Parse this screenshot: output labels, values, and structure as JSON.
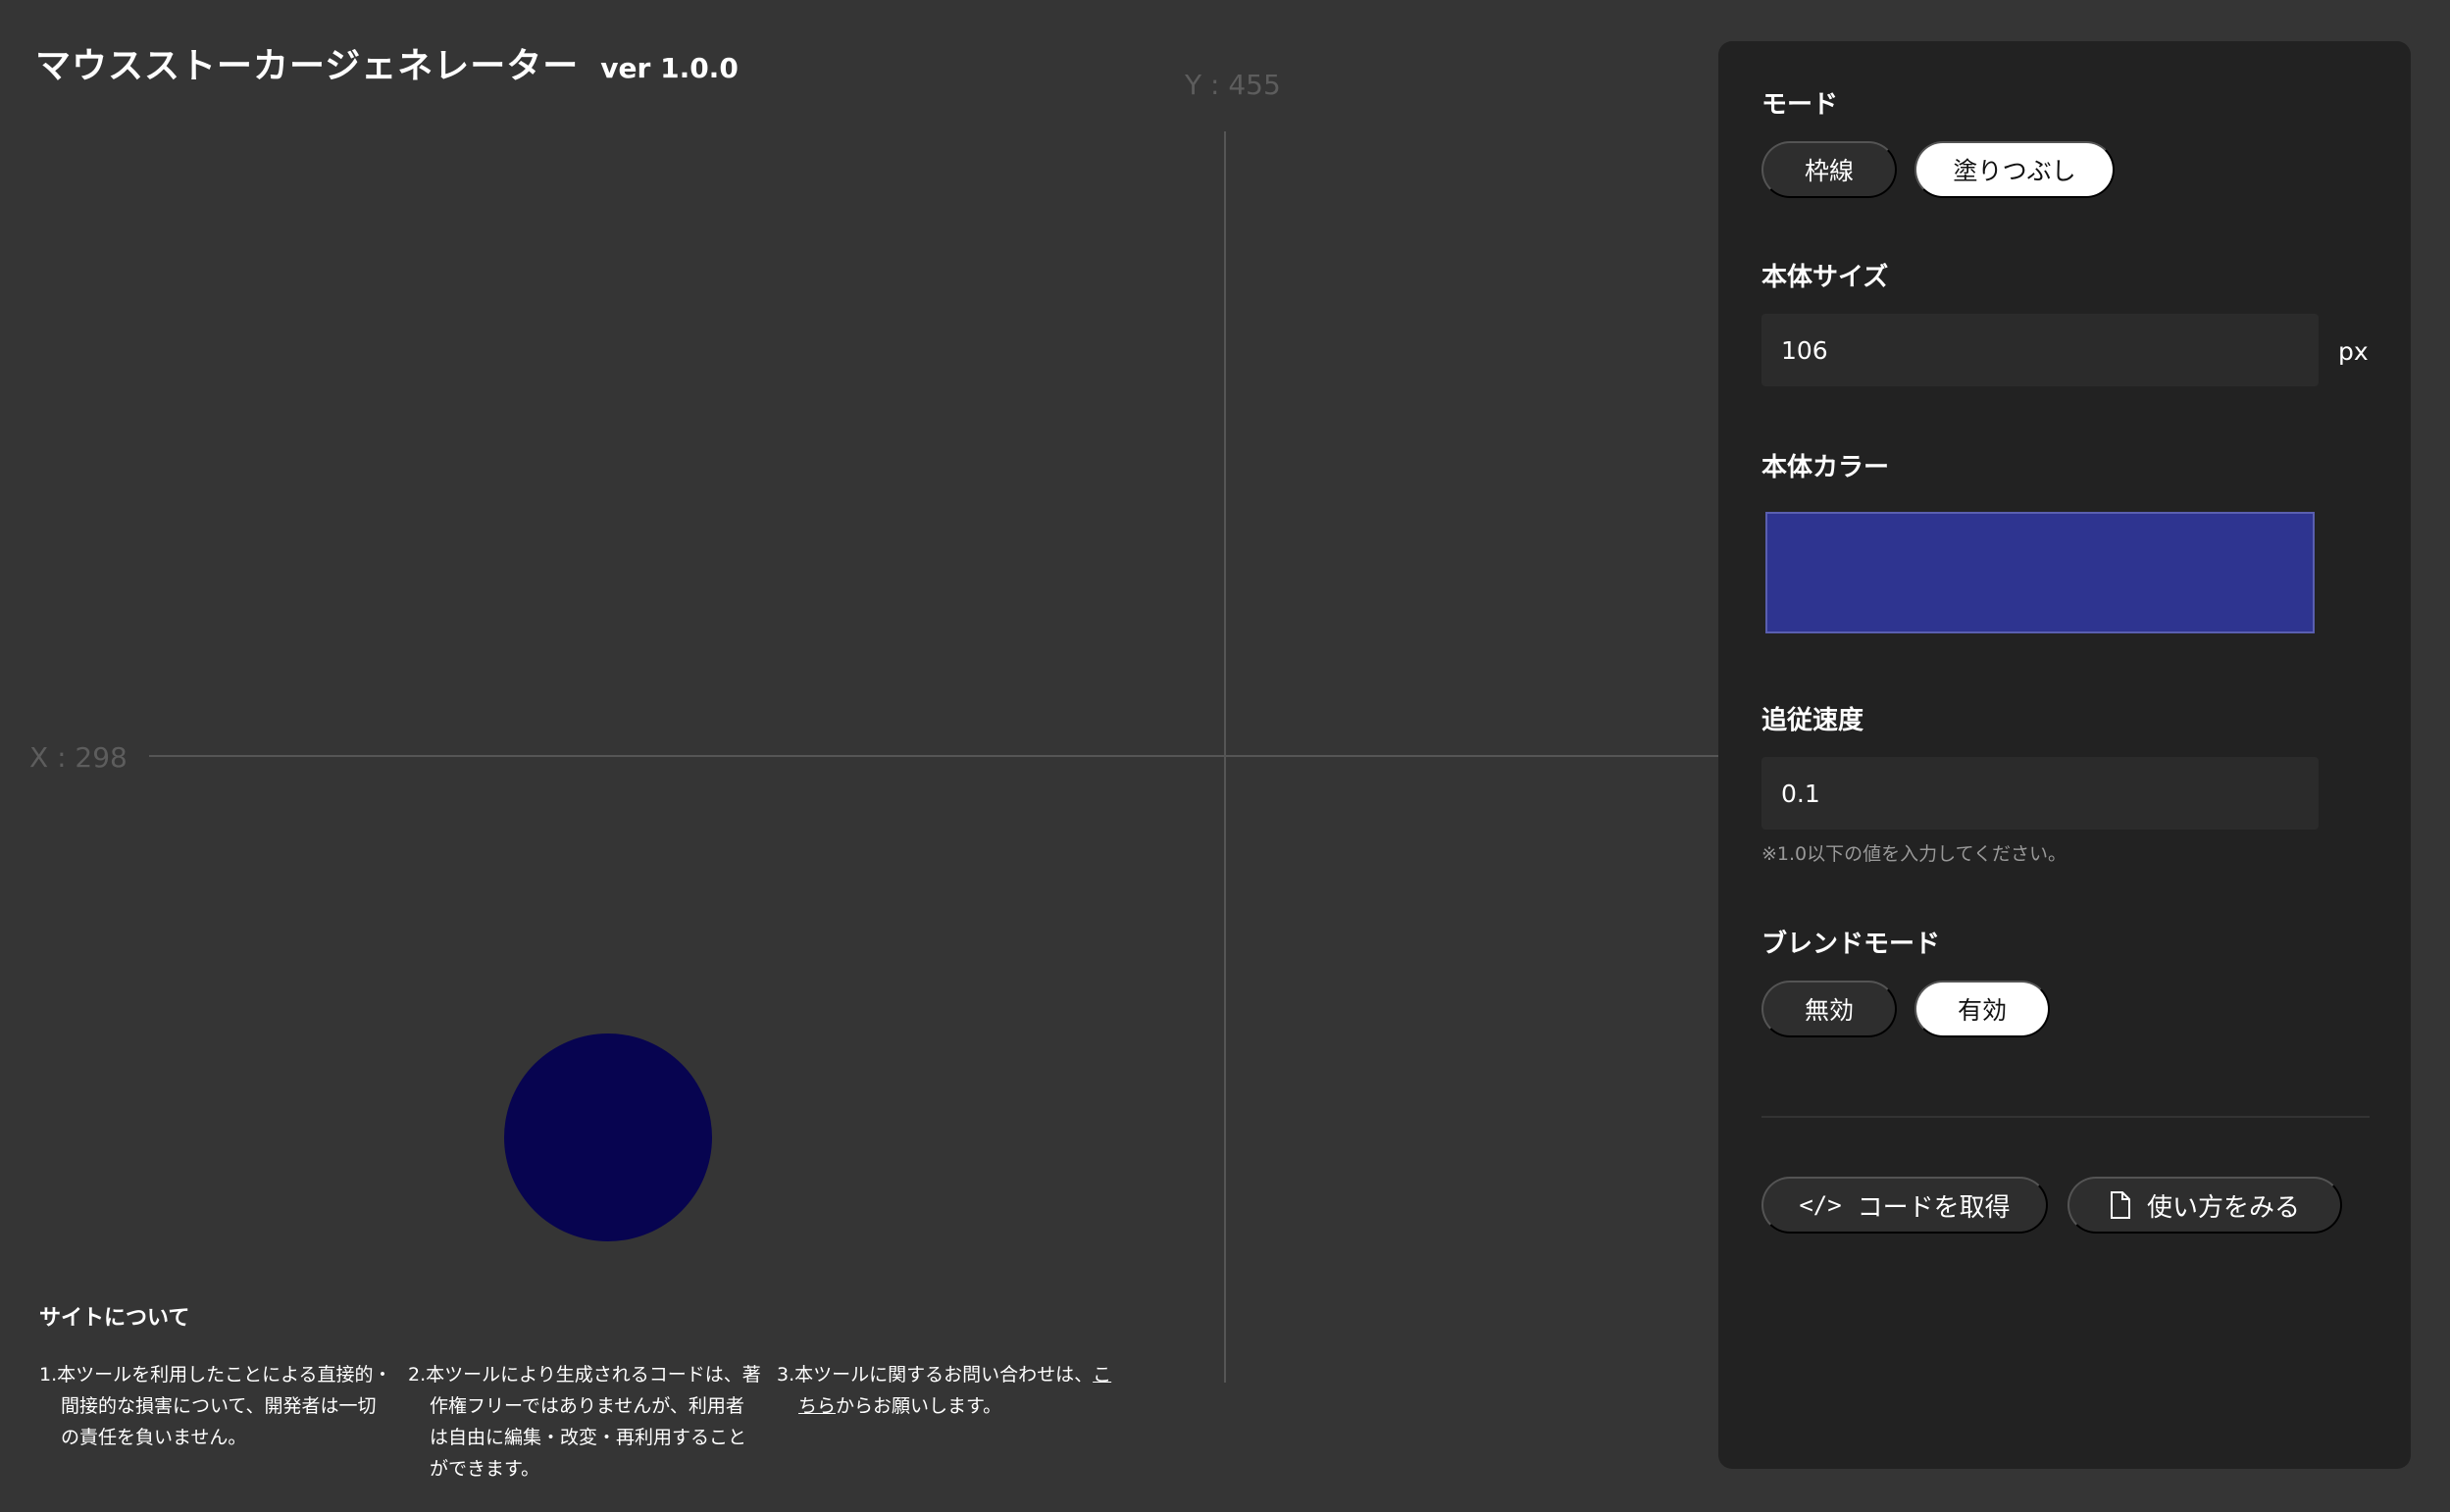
{
  "header": {
    "title": "マウスストーカージェネレーター",
    "version": "ver 1.0.0"
  },
  "canvas": {
    "x_readout": "X : 298",
    "y_readout": "Y : 455",
    "cursor_color": "#070450"
  },
  "about": {
    "title": "サイトについて",
    "note1": "1.本ツールを利用したことによる直接的・間接的な損害について、開発者は一切の責任を負いません。",
    "note2": "2.本ツールにより生成されるコードは、著作権フリーではありませんが、利用者は自由に編集・改変・再利用することができます。",
    "note3_prefix": "3.本ツールに関するお問い合わせは、",
    "note3_link": "こちら",
    "note3_suffix": "からお願いします。"
  },
  "settings": {
    "mode": {
      "label": "モード",
      "options": [
        "枠線",
        "塗りつぶし"
      ],
      "selected": "塗りつぶし"
    },
    "size": {
      "label": "本体サイズ",
      "value": "106",
      "unit": "px"
    },
    "color": {
      "label": "本体カラー",
      "value": "#2e3490"
    },
    "speed": {
      "label": "追従速度",
      "value": "0.1",
      "hint": "※1.0以下の値を入力してください。"
    },
    "blend": {
      "label": "ブレンドモード",
      "options": [
        "無効",
        "有効"
      ],
      "selected": "有効"
    }
  },
  "actions": {
    "get_code_icon": "</>",
    "get_code_label": "コードを取得",
    "howto_label": "使い方をみる"
  }
}
